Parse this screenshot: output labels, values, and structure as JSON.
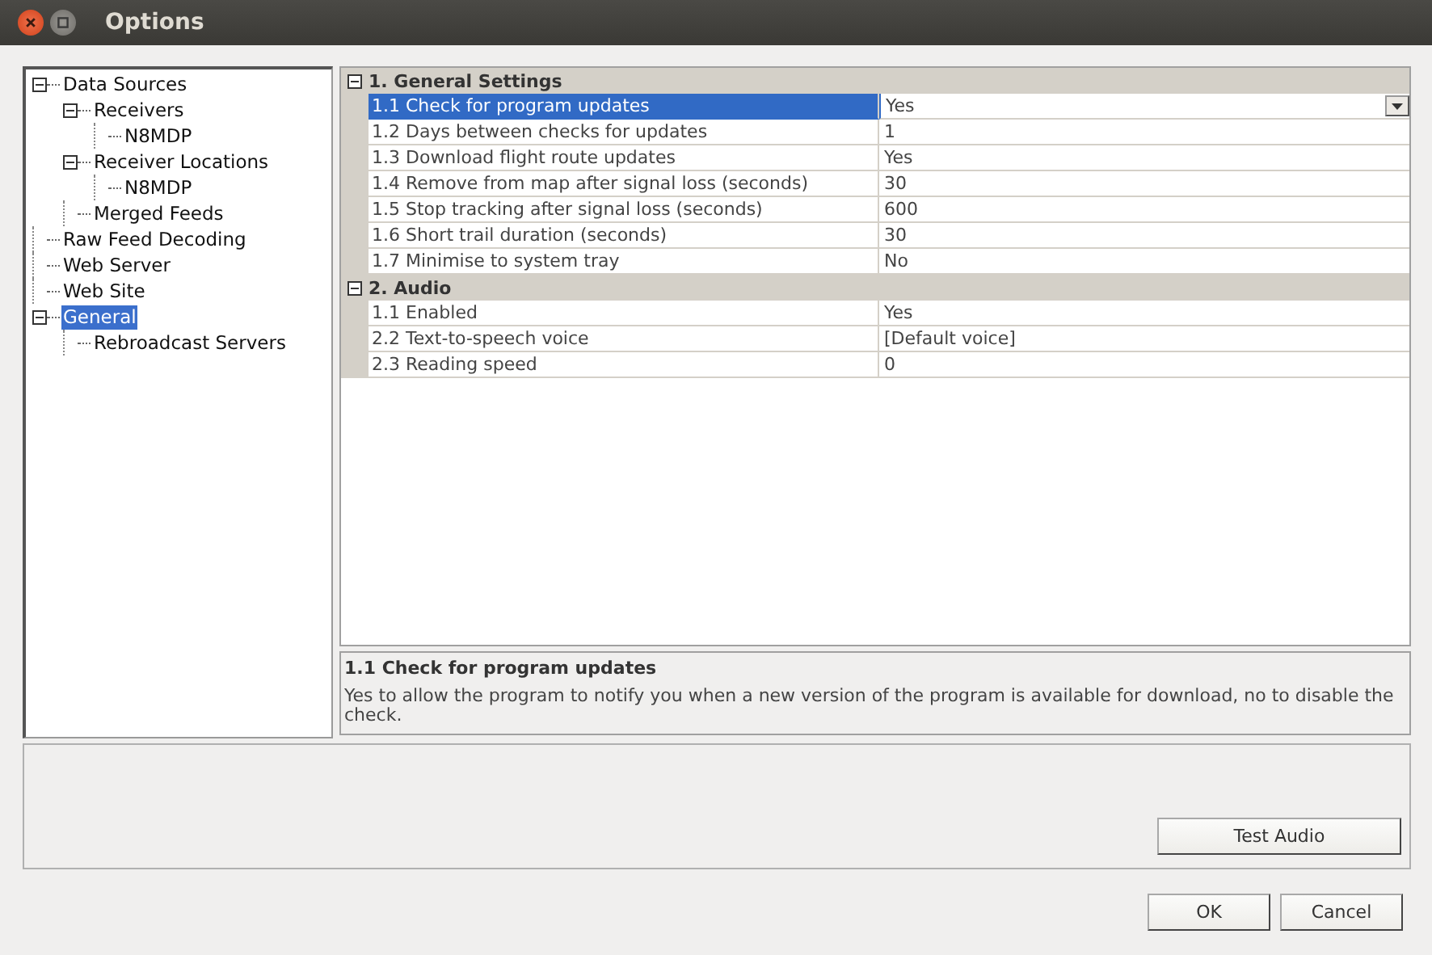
{
  "window": {
    "title": "Options"
  },
  "tree": [
    {
      "label": "Data Sources",
      "expanded": true,
      "selected": false,
      "children": [
        {
          "label": "Receivers",
          "expanded": true,
          "selected": false,
          "children": [
            {
              "label": "N8MDP",
              "selected": false
            }
          ]
        },
        {
          "label": "Receiver Locations",
          "expanded": true,
          "selected": false,
          "children": [
            {
              "label": "N8MDP",
              "selected": false
            }
          ]
        },
        {
          "label": "Merged Feeds",
          "selected": false
        }
      ]
    },
    {
      "label": "Raw Feed Decoding",
      "selected": false
    },
    {
      "label": "Web Server",
      "selected": false
    },
    {
      "label": "Web Site",
      "selected": false
    },
    {
      "label": "General",
      "expanded": true,
      "selected": true,
      "children": [
        {
          "label": "Rebroadcast Servers",
          "selected": false
        }
      ]
    }
  ],
  "property_grid": {
    "categories": [
      {
        "label": "1. General Settings",
        "expanded": true,
        "rows": [
          {
            "name": "1.1 Check for program updates",
            "value": "Yes",
            "selected": true
          },
          {
            "name": "1.2 Days between checks for updates",
            "value": "1",
            "selected": false
          },
          {
            "name": "1.3 Download flight route updates",
            "value": "Yes",
            "selected": false
          },
          {
            "name": "1.4 Remove from map after signal loss (seconds)",
            "value": "30",
            "selected": false
          },
          {
            "name": "1.5 Stop tracking after signal loss (seconds)",
            "value": "600",
            "selected": false
          },
          {
            "name": "1.6 Short trail duration (seconds)",
            "value": "30",
            "selected": false
          },
          {
            "name": "1.7 Minimise to system tray",
            "value": "No",
            "selected": false
          }
        ]
      },
      {
        "label": "2. Audio",
        "expanded": true,
        "rows": [
          {
            "name": "1.1 Enabled",
            "value": "Yes",
            "selected": false
          },
          {
            "name": "2.2 Text-to-speech voice",
            "value": "[Default voice]",
            "selected": false
          },
          {
            "name": "2.3 Reading speed",
            "value": "0",
            "selected": false
          }
        ]
      }
    ]
  },
  "description": {
    "title": "1.1 Check for program updates",
    "text": "Yes to allow the program to notify you when a new version of the program is available for download, no to disable the check."
  },
  "panel_buttons": [
    "Test Audio"
  ],
  "buttons": [
    "OK",
    "Cancel"
  ]
}
